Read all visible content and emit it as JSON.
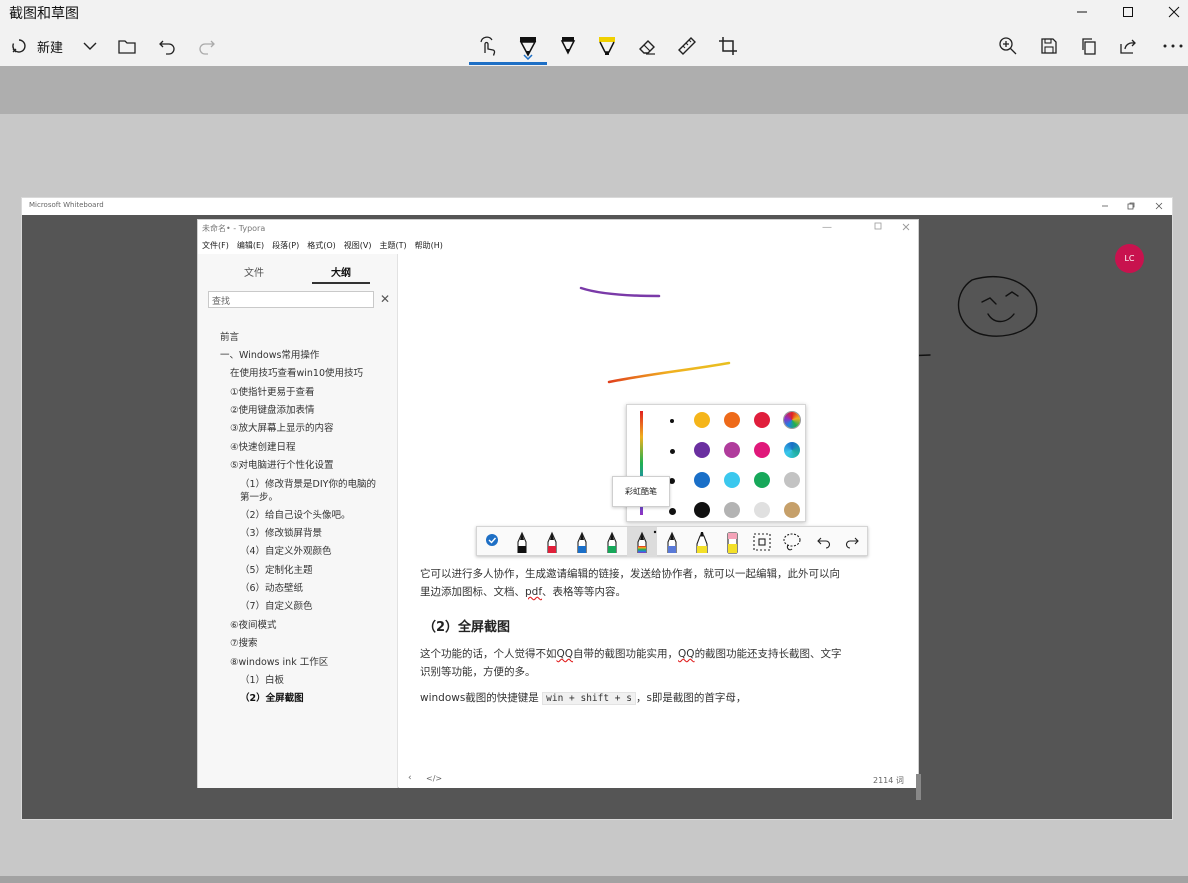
{
  "app": {
    "title": "截图和草图"
  },
  "toolbar": {
    "new_label": "新建"
  },
  "whiteboard": {
    "title": "Microsoft Whiteboard",
    "avatar_initials": "LC"
  },
  "typora": {
    "title": "未命名• - Typora",
    "menu": [
      "文件(F)",
      "编辑(E)",
      "段落(P)",
      "格式(O)",
      "视图(V)",
      "主题(T)",
      "帮助(H)"
    ],
    "sidebar": {
      "tab_files": "文件",
      "tab_outline": "大纲",
      "search_placeholder": "查找",
      "outline": [
        "前言",
        "一、Windows常用操作",
        "在使用技巧查看win10使用技巧",
        "①使指针更易于查看",
        "②使用键盘添加表情",
        "③放大屏幕上显示的内容",
        "④快速创建日程",
        "⑤对电脑进行个性化设置",
        "（1）修改背景是DIY你的电脑的",
        "第一步。",
        "（2）给自己设个头像吧。",
        "（3）修改锁屏背景",
        "（4）自定义外观颜色",
        "（5）定制化主题",
        "（6）动态壁纸",
        "（7）自定义颜色",
        "⑥夜间模式",
        "⑦搜索",
        "⑧windows ink 工作区",
        "（1）白板",
        "（2）全屏截图"
      ]
    },
    "content": {
      "para1_line1": "它可以进行多人协作，生成邀请编辑的链接，发送给协作者，就可以一起编辑，此外可以向",
      "para1_line2_a": "里边添加图标、文档、",
      "para1_line2_pdf": "pdf",
      "para1_line2_b": "、表格等等内容。",
      "heading": "（2）全屏截图",
      "para2_line1_a": "这个功能的话，个人觉得不如",
      "para2_qq1": "QQ",
      "para2_line1_b": "自带的截图功能实用，",
      "para2_qq2": "QQ",
      "para2_line1_c": "的截图功能还支持长截图、文字",
      "para2_line2": "识别等功能，方便的多。",
      "para3_a": "windows截图的快捷键是 ",
      "para3_code": "win + shift + s",
      "para3_b": "，s即是截图的首字母，"
    },
    "status": {
      "back": "‹",
      "source": "</>",
      "word_count": "2114 词"
    }
  },
  "pen_palette": {
    "tooltip": "彩虹酷笔",
    "swatches": [
      [
        "#f5b51a",
        "#ee6a1a",
        "#e01e3c",
        "rainbow"
      ],
      [
        "#6a2fa0",
        "#b03c9c",
        "#e0187a",
        "ocean"
      ],
      [
        "#1a6fc8",
        "#3bc8ee",
        "#17a85a",
        "#c3c3c3"
      ],
      [
        "#111111",
        "#b3b3b3",
        "#e0e0e0",
        "#c6a06a"
      ]
    ]
  },
  "colors": {
    "accent": "#1e6fc5",
    "avatar": "#c8124e",
    "whiteboard_bg": "#555555"
  }
}
